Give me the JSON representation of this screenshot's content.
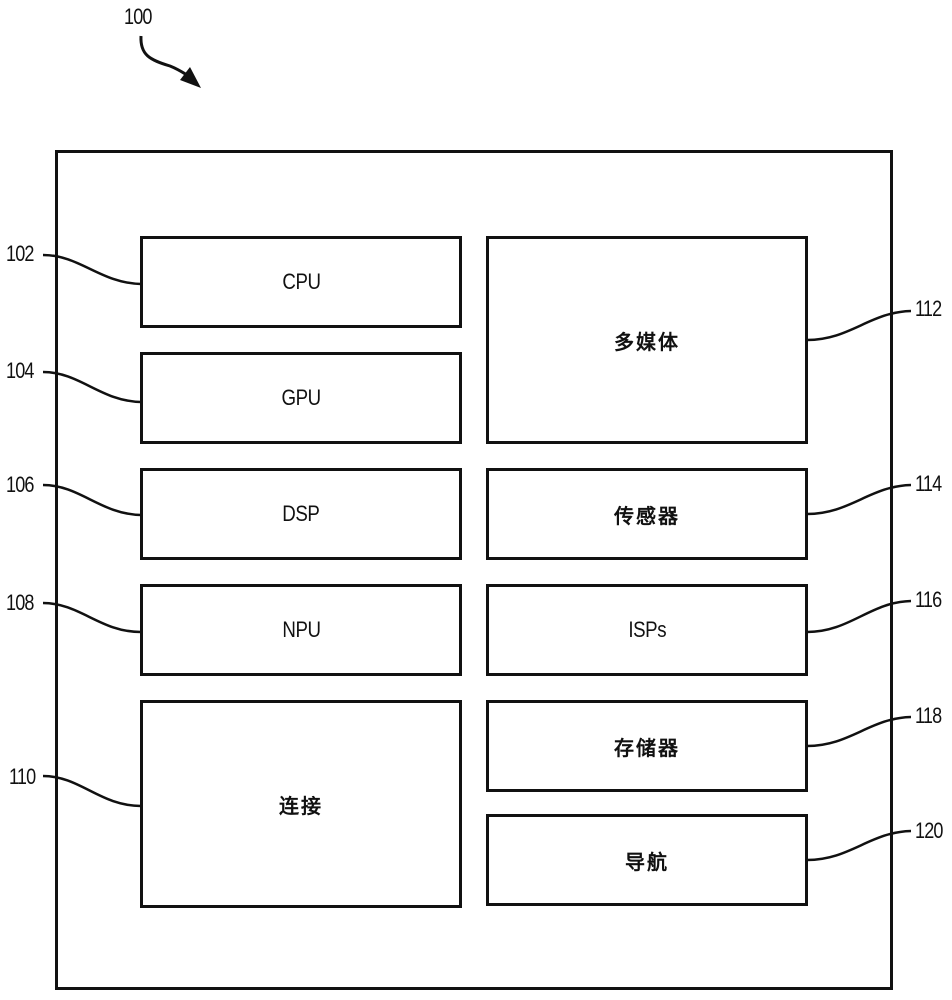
{
  "figure": {
    "reference": "100"
  },
  "left_column": [
    {
      "id": "cpu",
      "label": "CPU",
      "ref": "102"
    },
    {
      "id": "gpu",
      "label": "GPU",
      "ref": "104"
    },
    {
      "id": "dsp",
      "label": "DSP",
      "ref": "106"
    },
    {
      "id": "npu",
      "label": "NPU",
      "ref": "108"
    },
    {
      "id": "connectivity",
      "label": "连接",
      "ref": "110"
    }
  ],
  "right_column": [
    {
      "id": "multimedia",
      "label": "多媒体",
      "ref": "112"
    },
    {
      "id": "sensor",
      "label": "传感器",
      "ref": "114"
    },
    {
      "id": "isps",
      "label": "ISPs",
      "ref": "116"
    },
    {
      "id": "memory",
      "label": "存储器",
      "ref": "118"
    },
    {
      "id": "navigation",
      "label": "导航",
      "ref": "120"
    }
  ]
}
